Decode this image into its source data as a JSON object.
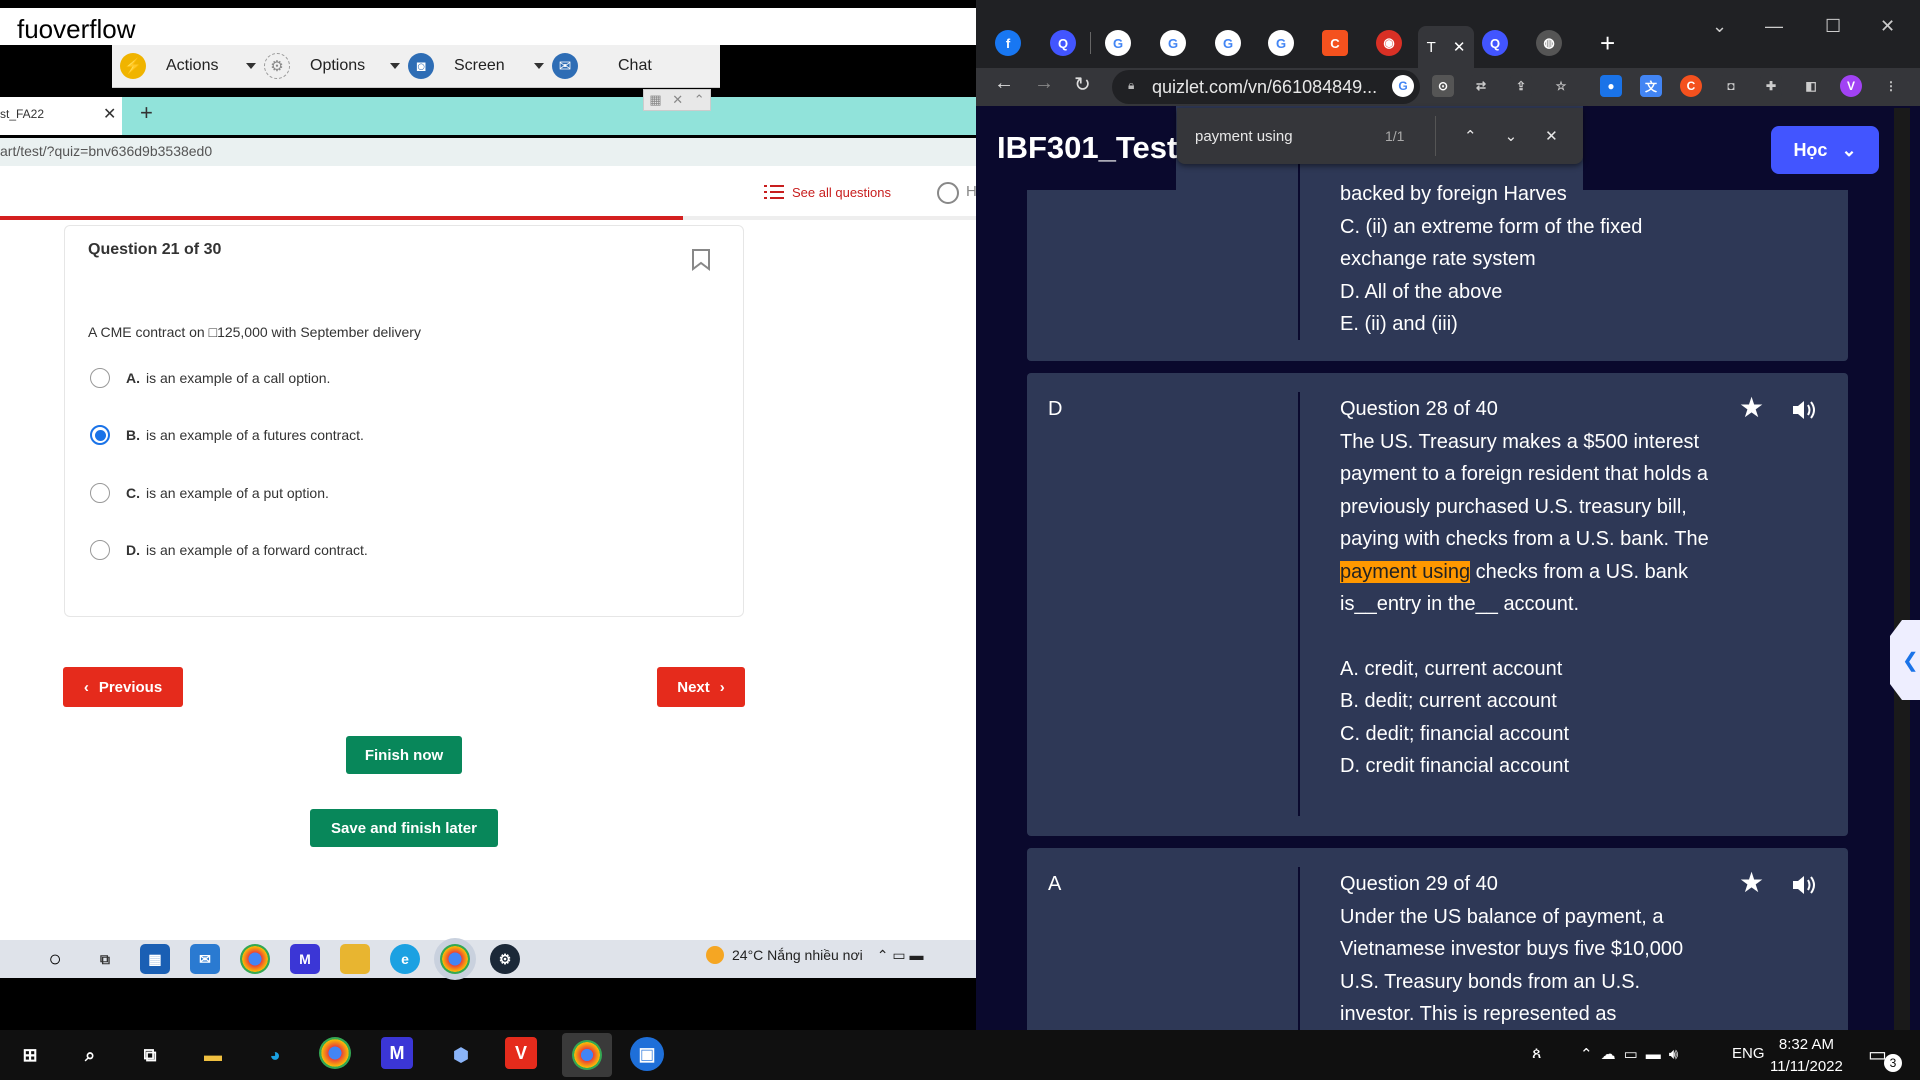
{
  "remote": {
    "title": "fuoverflow",
    "toolbar": {
      "actions": "Actions",
      "options": "Options",
      "screen": "Screen",
      "chat": "Chat"
    },
    "tab_label": "st_FA22",
    "url": "art/test/?quiz=bnv636d9b3538ed0",
    "see_all": "See all questions",
    "help_letter": "H"
  },
  "quiz": {
    "question_number": "Question 21 of 30",
    "question_text": "A CME contract on □125,000 with September delivery",
    "progress_fraction": 0.7,
    "options": [
      {
        "letter": "A.",
        "text": "is an example of a call option.",
        "selected": false
      },
      {
        "letter": "B.",
        "text": "is an example of a futures contract.",
        "selected": true
      },
      {
        "letter": "C.",
        "text": "is an example of a put option.",
        "selected": false
      },
      {
        "letter": "D.",
        "text": "is an example of a forward contract.",
        "selected": false
      }
    ],
    "previous_label": "Previous",
    "next_label": "Next",
    "finish_label": "Finish now",
    "save_label": "Save and finish later"
  },
  "remote_taskbar": {
    "weather": "24°C  Nắng nhiều nơi"
  },
  "browser": {
    "url": "quizlet.com/vn/661084849...",
    "active_tab_label": "T",
    "find_query": "payment using",
    "find_count": "1/1",
    "profile_letter": "V"
  },
  "quizlet": {
    "title": "IBF301_Test1",
    "hoc_label": "Học",
    "prev_card": {
      "lines": [
        "backed by foreign Harves",
        "C. (ii) an extreme form of the fixed exchange rate system",
        "D. All of the above",
        "E. (ii) and (iii)"
      ]
    },
    "card28": {
      "term": "D",
      "header": "Question 28 of 40",
      "text_before": "The US. Treasury makes a $500 interest payment to a foreign resident that holds a previously purchased U.S. treasury bill, paying with checks from a U.S. bank. The ",
      "highlight": "payment using",
      "text_after": " checks from a US. bank is__entry in the__ account.",
      "options": [
        "A. credit, current account",
        "B. dedit; current account",
        "C. dedit; financial account",
        "D. credit financial account"
      ]
    },
    "card29": {
      "term": "A",
      "header": "Question 29 of 40",
      "text": "Under the US balance of payment, a Vietnamese investor buys five $10,000 U.S. Treasury bonds from an U.S. investor. This is represented as"
    }
  },
  "taskbar": {
    "lang": "ENG",
    "time": "8:32 AM",
    "date": "11/11/2022",
    "notif_count": "3"
  },
  "colors": {
    "accent_red": "#e52b1c",
    "accent_green": "#08875a",
    "quizlet_blue": "#4255ff",
    "highlight": "#ff9800"
  }
}
